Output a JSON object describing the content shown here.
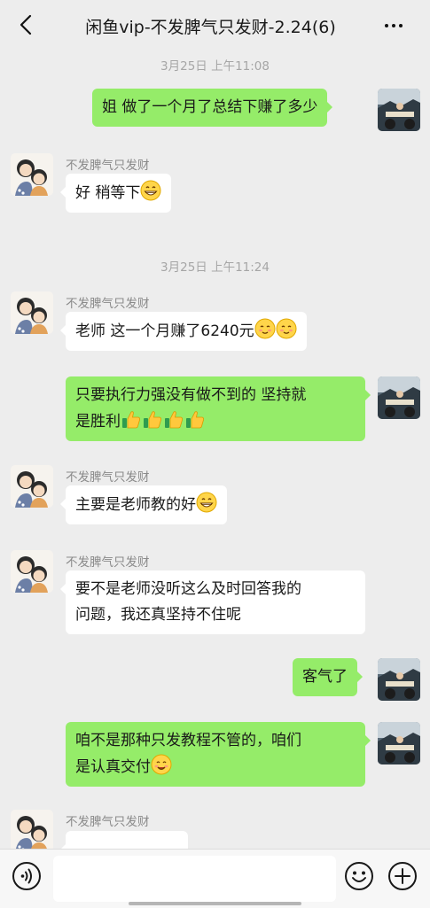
{
  "header": {
    "title": "闲鱼vip-不发脾气只发财-2.24(6)"
  },
  "colors": {
    "background": "#ededed",
    "sent_bubble": "#95ec69",
    "received_bubble": "#ffffff"
  },
  "messages": [
    {
      "type": "time",
      "text": "3月25日 上午11:08"
    },
    {
      "type": "sent",
      "text": "姐 做了一个月了总结下赚了多少"
    },
    {
      "type": "received",
      "sender": "不发脾气只发财",
      "text": "好 稍等下",
      "emoji": [
        "grin-emoji"
      ]
    },
    {
      "type": "time",
      "text": "3月25日 上午11:24"
    },
    {
      "type": "received",
      "sender": "不发脾气只发财",
      "text": "老师  这一个月赚了6240元",
      "emoji": [
        "blush-emoji",
        "blush-emoji"
      ]
    },
    {
      "type": "sent",
      "line1": "只要执行力强没有做不到的 坚持就",
      "line2": "是胜利",
      "emoji": [
        "thumbs-up-emoji",
        "thumbs-up-emoji",
        "thumbs-up-emoji",
        "thumbs-up-emoji"
      ]
    },
    {
      "type": "received",
      "sender": "不发脾气只发财",
      "text": "主要是老师教的好",
      "emoji": [
        "grin-emoji"
      ]
    },
    {
      "type": "received",
      "sender": "不发脾气只发财",
      "line1": "要不是老师没听这么及时回答我的",
      "line2": "问题，我还真坚持不住呢"
    },
    {
      "type": "sent",
      "text": "客气了"
    },
    {
      "type": "sent",
      "line1": "咱不是那种只发教程不管的，咱们",
      "line2": "是认真交付",
      "emoji": [
        "smile-emoji"
      ]
    },
    {
      "type": "received",
      "sender": "不发脾气只发财",
      "text": ""
    }
  ],
  "composer": {
    "placeholder": ""
  }
}
